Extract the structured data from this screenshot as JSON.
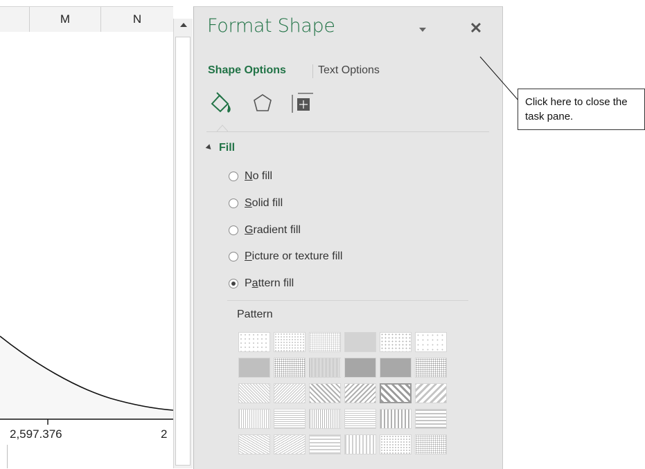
{
  "spreadsheet": {
    "columns": [
      "M",
      "N"
    ],
    "axis_labels": [
      "2,597.376",
      "2"
    ]
  },
  "pane": {
    "title": "Format Shape",
    "tabs": {
      "shape_options": "Shape Options",
      "text_options": "Text Options"
    },
    "category_icons": [
      "fill-line-icon",
      "effects-icon",
      "size-properties-icon"
    ],
    "section": {
      "label": "Fill",
      "options": [
        {
          "prefix": "",
          "accel": "N",
          "rest": "o fill",
          "checked": false
        },
        {
          "prefix": "",
          "accel": "S",
          "rest": "olid fill",
          "checked": false
        },
        {
          "prefix": "",
          "accel": "G",
          "rest": "radient fill",
          "checked": false
        },
        {
          "prefix": "",
          "accel": "P",
          "rest": "icture or texture fill",
          "checked": false
        },
        {
          "prefix": "P",
          "accel": "a",
          "rest": "ttern fill",
          "checked": true
        }
      ],
      "pattern_label": "Pattern"
    },
    "accent_color": "#217346"
  },
  "callout": {
    "text": "Click here to close the task pane."
  }
}
